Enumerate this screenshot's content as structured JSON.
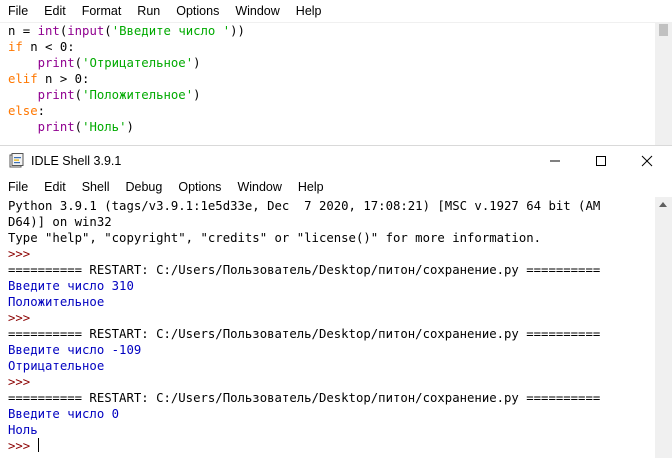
{
  "editor": {
    "menu": [
      "File",
      "Edit",
      "Format",
      "Run",
      "Options",
      "Window",
      "Help"
    ],
    "code": {
      "l1": {
        "a": "n = ",
        "b": "int",
        "c": "(",
        "d": "input",
        "e": "(",
        "f": "'Введите число '",
        "g": "))"
      },
      "l2": {
        "kw": "if",
        "rest": " n < 0:"
      },
      "l3": {
        "ind": "    ",
        "bi": "print",
        "o": "(",
        "s": "'Отрицательное'",
        "c": ")"
      },
      "l4": {
        "kw": "elif",
        "rest": " n > 0:"
      },
      "l5": {
        "ind": "    ",
        "bi": "print",
        "o": "(",
        "s": "'Положительное'",
        "c": ")"
      },
      "l6": {
        "kw": "else",
        "rest": ":"
      },
      "l7": {
        "ind": "    ",
        "bi": "print",
        "o": "(",
        "s": "'Ноль'",
        "c": ")"
      }
    }
  },
  "shell": {
    "title": "IDLE Shell 3.9.1",
    "menu": [
      "File",
      "Edit",
      "Shell",
      "Debug",
      "Options",
      "Window",
      "Help"
    ],
    "lines": [
      {
        "cls": "std",
        "text": "Python 3.9.1 (tags/v3.9.1:1e5d33e, Dec  7 2020, 17:08:21) [MSC v.1927 64 bit (AM"
      },
      {
        "cls": "std",
        "text": "D64)] on win32"
      },
      {
        "cls": "std",
        "text": "Type \"help\", \"copyright\", \"credits\" or \"license()\" for more information."
      },
      {
        "cls": "prompt",
        "text": ">>> "
      },
      {
        "cls": "std",
        "text": "========== RESTART: C:/Users/Пользователь/Desktop/питон/сохранение.py =========="
      },
      {
        "cls": "out",
        "text": "Введите число 310"
      },
      {
        "cls": "out",
        "text": "Положительное"
      },
      {
        "cls": "prompt",
        "text": ">>> "
      },
      {
        "cls": "std",
        "text": "========== RESTART: C:/Users/Пользователь/Desktop/питон/сохранение.py =========="
      },
      {
        "cls": "out",
        "text": "Введите число -109"
      },
      {
        "cls": "out",
        "text": "Отрицательное"
      },
      {
        "cls": "prompt",
        "text": ">>> "
      },
      {
        "cls": "std",
        "text": "========== RESTART: C:/Users/Пользователь/Desktop/питон/сохранение.py =========="
      },
      {
        "cls": "out",
        "text": "Введите число 0"
      },
      {
        "cls": "out",
        "text": "Ноль"
      },
      {
        "cls": "prompt",
        "text": ">>> "
      }
    ]
  }
}
